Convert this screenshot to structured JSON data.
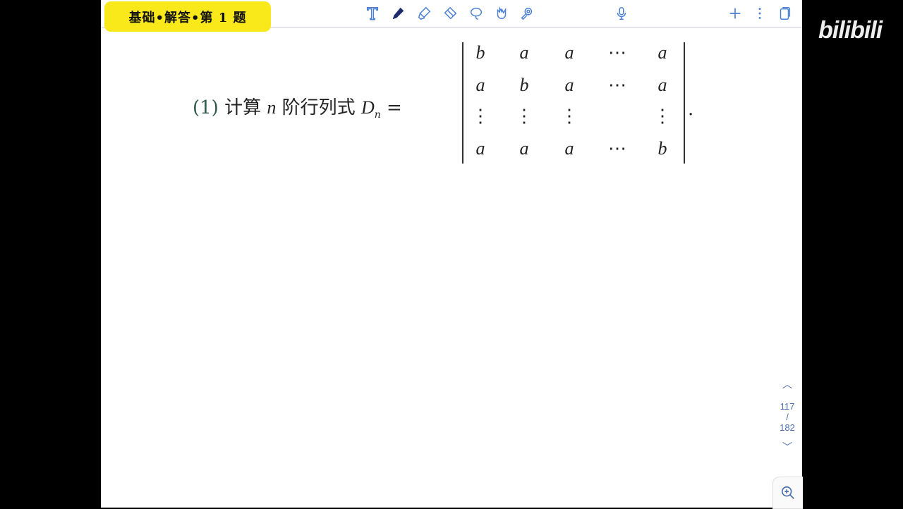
{
  "header": {
    "title_badge": "基础•解答•第 1 题"
  },
  "toolbar": {
    "tools": [
      "text-tool",
      "pen-tool",
      "highlighter-tool",
      "eraser-tool",
      "lasso-tool",
      "hand-tool",
      "laser-pointer-tool"
    ],
    "accent": "#4a7fd4"
  },
  "question": {
    "number": "(1)",
    "text_before": "计算",
    "var_n": "n",
    "text_after": "阶行列式",
    "symbol": "D",
    "subscript": "n",
    "equals": "=",
    "matrix": [
      [
        "b",
        "a",
        "a",
        "⋯",
        "a"
      ],
      [
        "a",
        "b",
        "a",
        "⋯",
        "a"
      ],
      [
        "⋮",
        "⋮",
        "⋮",
        "",
        "⋮"
      ],
      [
        "a",
        "a",
        "a",
        "⋯",
        "b"
      ]
    ],
    "period": "."
  },
  "pager": {
    "current": "117",
    "separator": "/",
    "total": "182"
  },
  "watermark": "bilibili"
}
